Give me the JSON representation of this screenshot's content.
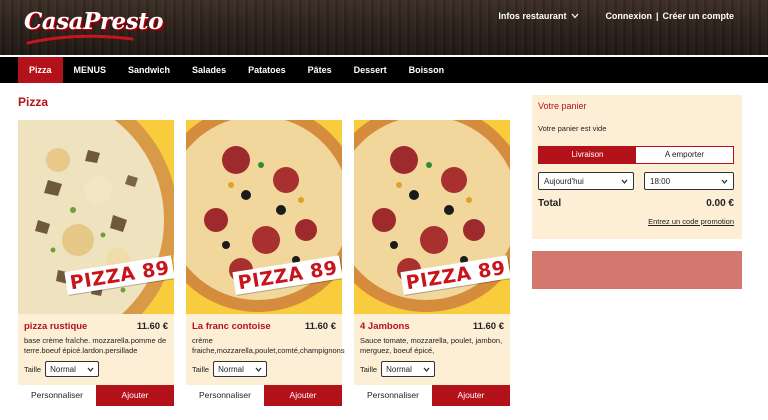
{
  "brand": {
    "name": "CasaPresto",
    "primary_color": "#b3121b",
    "panel_color": "#fdeed6",
    "pizza_bg": "#f9cc3d"
  },
  "header": {
    "infos_label": "Infos restaurant",
    "login_label": "Connexion",
    "separator": "|",
    "register_label": "Créer un compte"
  },
  "categories": [
    {
      "label": "Pizza",
      "active": true
    },
    {
      "label": "MENUS",
      "active": false
    },
    {
      "label": "Sandwich",
      "active": false
    },
    {
      "label": "Salades",
      "active": false
    },
    {
      "label": "Patatoes",
      "active": false
    },
    {
      "label": "Pâtes",
      "active": false
    },
    {
      "label": "Dessert",
      "active": false
    },
    {
      "label": "Boisson",
      "active": false
    }
  ],
  "section_title": "Pizza",
  "products": [
    {
      "banner": "PIZZA 89",
      "name": "pizza rustique",
      "price": "11.60 €",
      "description": "base crème fraîche. mozzarella.pomme de terre.boeuf épicé.lardon.persillade",
      "size_label": "Taille",
      "size_value": "Normal",
      "customize_label": "Personnaliser",
      "add_label": "Ajouter"
    },
    {
      "banner": "PIZZA 89",
      "name": "La franc contoise",
      "price": "11.60 €",
      "description": "crème fraiche,mozzarella,poulet,comté,champignons",
      "size_label": "Taille",
      "size_value": "Normal",
      "customize_label": "Personnaliser",
      "add_label": "Ajouter"
    },
    {
      "banner": "PIZZA 89",
      "name": "4 Jambons",
      "price": "11.60 €",
      "description": "Sauce tomate, mozzarella, poulet, jambon, merguez, boeuf épicé,",
      "size_label": "Taille",
      "size_value": "Normal",
      "customize_label": "Personnaliser",
      "add_label": "Ajouter"
    }
  ],
  "cart": {
    "title": "Votre panier",
    "empty_text": "Votre panier est vide",
    "delivery_label": "Livraison",
    "takeaway_label": "A emporter",
    "day_value": "Aujourd'hui",
    "time_value": "18:00",
    "total_label": "Total",
    "total_value": "0.00 €",
    "promo_label": "Entrez un code promotion"
  },
  "icons": {
    "chevron": "chevron-down-icon"
  }
}
